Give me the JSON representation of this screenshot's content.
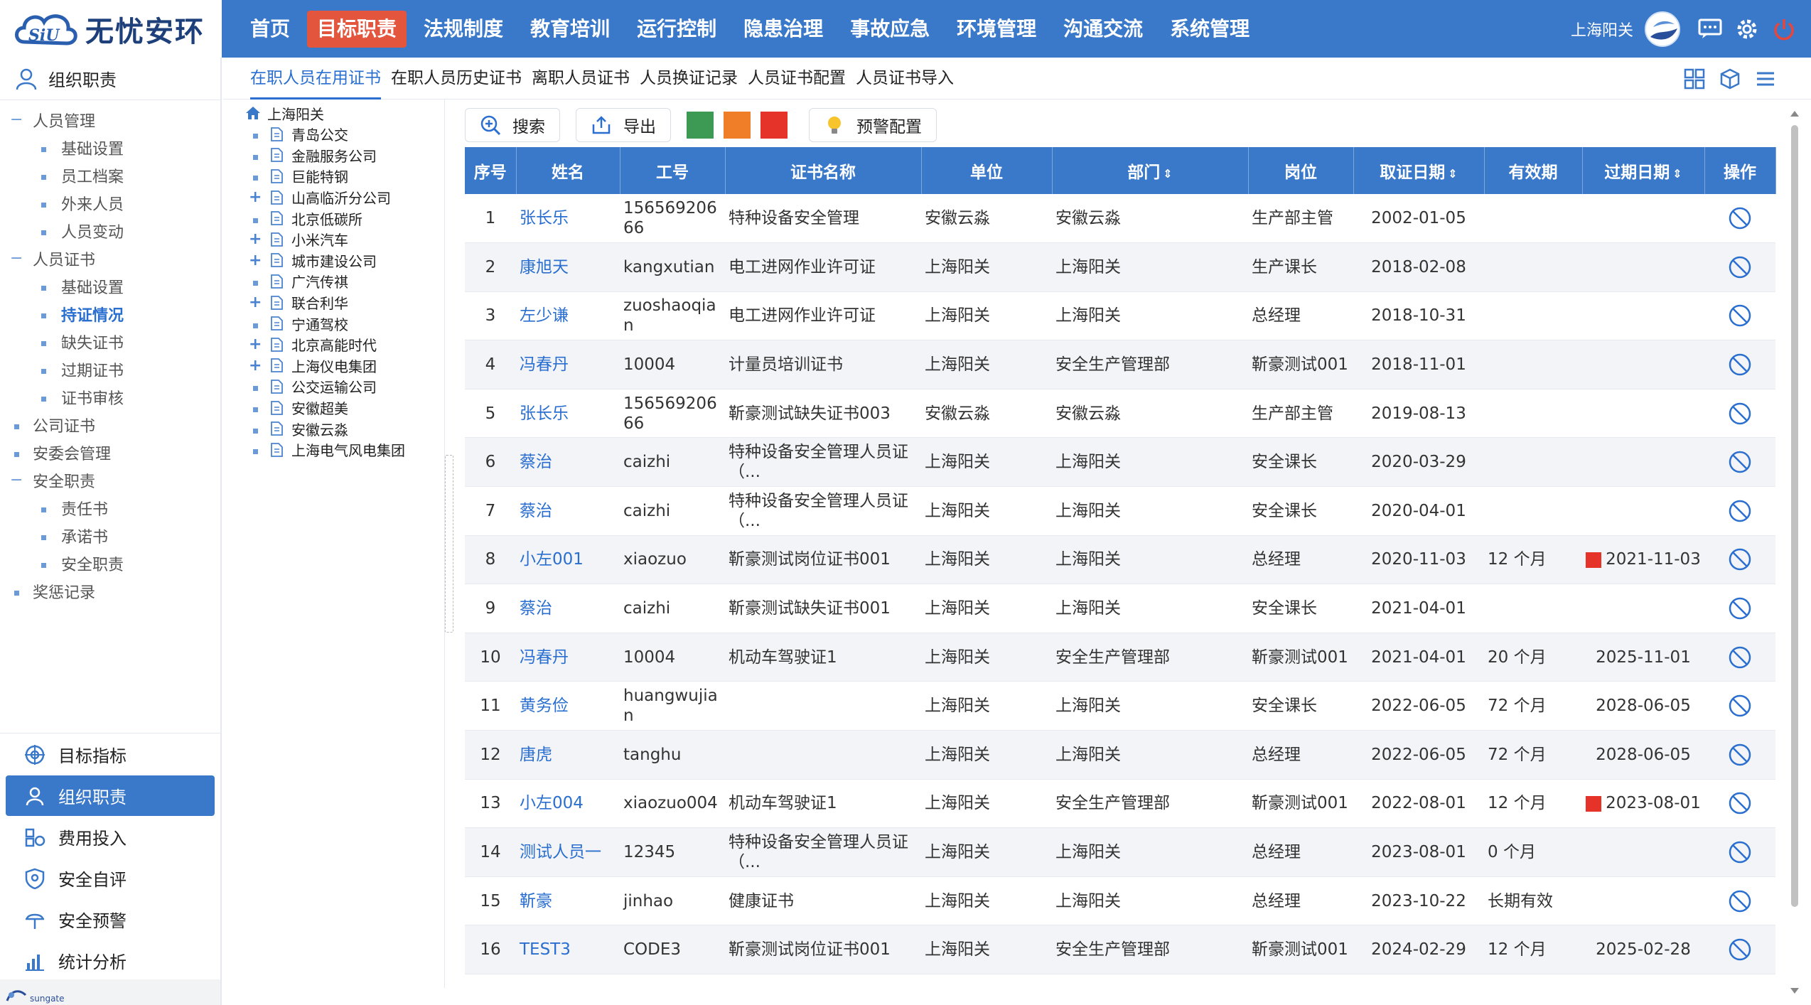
{
  "app": {
    "logo_text": "无忧安环",
    "logo_mark": "SiU",
    "user_name": "上海阳关",
    "colors": {
      "primary": "#3a78c9",
      "nav_active": "#e4553d",
      "link": "#2a6fd0",
      "warn_green": "#3d9a54",
      "warn_orange": "#f07e29",
      "warn_red": "#e53329"
    }
  },
  "nav": [
    "首页",
    "目标职责",
    "法规制度",
    "教育培训",
    "运行控制",
    "隐患治理",
    "事故应急",
    "环境管理",
    "沟通交流",
    "系统管理"
  ],
  "nav_active_index": 1,
  "top_icons": [
    "message-icon",
    "settings-icon",
    "power-icon"
  ],
  "sidebar": {
    "header": "组织职责",
    "tree": [
      {
        "level": 1,
        "mark": "−",
        "label": "人员管理"
      },
      {
        "level": 2,
        "label": "基础设置"
      },
      {
        "level": 2,
        "label": "员工档案"
      },
      {
        "level": 2,
        "label": "外来人员"
      },
      {
        "level": 2,
        "label": "人员变动"
      },
      {
        "level": 1,
        "mark": "−",
        "label": "人员证书"
      },
      {
        "level": 2,
        "label": "基础设置"
      },
      {
        "level": 2,
        "label": "持证情况",
        "active": true
      },
      {
        "level": 2,
        "label": "缺失证书"
      },
      {
        "level": 2,
        "label": "过期证书"
      },
      {
        "level": 2,
        "label": "证书审核"
      },
      {
        "level": 1,
        "mark": "dot",
        "label": "公司证书"
      },
      {
        "level": 1,
        "mark": "dot",
        "label": "安委会管理"
      },
      {
        "level": 1,
        "mark": "−",
        "label": "安全职责"
      },
      {
        "level": 2,
        "label": "责任书"
      },
      {
        "level": 2,
        "label": "承诺书"
      },
      {
        "level": 2,
        "label": "安全职责"
      },
      {
        "level": 1,
        "mark": "dot",
        "label": "奖惩记录"
      }
    ],
    "modules": [
      {
        "label": "目标指标",
        "icon": "target-icon"
      },
      {
        "label": "组织职责",
        "icon": "person-icon",
        "active": true
      },
      {
        "label": "费用投入",
        "icon": "money-icon"
      },
      {
        "label": "安全自评",
        "icon": "shield-icon"
      },
      {
        "label": "安全预警",
        "icon": "alarm-icon"
      },
      {
        "label": "统计分析",
        "icon": "chart-icon"
      }
    ],
    "footer_logo": "sungate"
  },
  "subtabs": [
    "在职人员在用证书",
    "在职人员历史证书",
    "离职人员证书",
    "人员换证记录",
    "人员证书配置",
    "人员证书导入"
  ],
  "subtab_active_index": 0,
  "org_tree": {
    "root": "上海阳关",
    "children": [
      {
        "label": "青岛公交",
        "expandable": false
      },
      {
        "label": "金融服务公司",
        "expandable": false
      },
      {
        "label": "巨能特钢",
        "expandable": false
      },
      {
        "label": "山高临沂分公司",
        "expandable": true
      },
      {
        "label": "北京低碳所",
        "expandable": false
      },
      {
        "label": "小米汽车",
        "expandable": true
      },
      {
        "label": "城市建设公司",
        "expandable": true
      },
      {
        "label": "广汽传祺",
        "expandable": false
      },
      {
        "label": "联合利华",
        "expandable": true
      },
      {
        "label": "宁通驾校",
        "expandable": false
      },
      {
        "label": "北京高能时代",
        "expandable": true
      },
      {
        "label": "上海仪电集团",
        "expandable": true
      },
      {
        "label": "公交运输公司",
        "expandable": false
      },
      {
        "label": "安徽超美",
        "expandable": false
      },
      {
        "label": "安徽云淼",
        "expandable": false
      },
      {
        "label": "上海电气风电集团",
        "expandable": false
      }
    ]
  },
  "toolbar": {
    "search": "搜索",
    "export": "导出",
    "warning_config": "预警配置"
  },
  "table": {
    "headers": [
      {
        "label": "序号",
        "sortable": false
      },
      {
        "label": "姓名",
        "sortable": false
      },
      {
        "label": "工号",
        "sortable": false
      },
      {
        "label": "证书名称",
        "sortable": false
      },
      {
        "label": "单位",
        "sortable": false
      },
      {
        "label": "部门",
        "sortable": true
      },
      {
        "label": "岗位",
        "sortable": false
      },
      {
        "label": "取证日期",
        "sortable": true
      },
      {
        "label": "有效期",
        "sortable": false
      },
      {
        "label": "过期日期",
        "sortable": true
      },
      {
        "label": "操作",
        "sortable": false
      }
    ],
    "rows": [
      {
        "no": "1",
        "name": "张长乐",
        "id": "15656920666",
        "cert": "特种设备安全管理",
        "unit": "安徽云淼",
        "dept": "安徽云淼",
        "post": "生产部主管",
        "issued": "2002-01-05",
        "valid": "",
        "expire": "",
        "expired": false
      },
      {
        "no": "2",
        "name": "康旭天",
        "id": "kangxutian",
        "cert": "电工进网作业许可证",
        "unit": "上海阳关",
        "dept": "上海阳关",
        "post": "生产课长",
        "issued": "2018-02-08",
        "valid": "",
        "expire": "",
        "expired": false
      },
      {
        "no": "3",
        "name": "左少谦",
        "id": "zuoshaoqian",
        "cert": "电工进网作业许可证",
        "unit": "上海阳关",
        "dept": "上海阳关",
        "post": "总经理",
        "issued": "2018-10-31",
        "valid": "",
        "expire": "",
        "expired": false
      },
      {
        "no": "4",
        "name": "冯春丹",
        "id": "10004",
        "cert": "计量员培训证书",
        "unit": "上海阳关",
        "dept": "安全生产管理部",
        "post": "靳豪测试001",
        "issued": "2018-11-01",
        "valid": "",
        "expire": "",
        "expired": false
      },
      {
        "no": "5",
        "name": "张长乐",
        "id": "15656920666",
        "cert": "靳豪测试缺失证书003",
        "unit": "安徽云淼",
        "dept": "安徽云淼",
        "post": "生产部主管",
        "issued": "2019-08-13",
        "valid": "",
        "expire": "",
        "expired": false
      },
      {
        "no": "6",
        "name": "蔡治",
        "id": "caizhi",
        "cert": "特种设备安全管理人员证（...",
        "unit": "上海阳关",
        "dept": "上海阳关",
        "post": "安全课长",
        "issued": "2020-03-29",
        "valid": "",
        "expire": "",
        "expired": false
      },
      {
        "no": "7",
        "name": "蔡治",
        "id": "caizhi",
        "cert": "特种设备安全管理人员证（...",
        "unit": "上海阳关",
        "dept": "上海阳关",
        "post": "安全课长",
        "issued": "2020-04-01",
        "valid": "",
        "expire": "",
        "expired": false
      },
      {
        "no": "8",
        "name": "小左001",
        "id": "xiaozuo",
        "cert": "靳豪测试岗位证书001",
        "unit": "上海阳关",
        "dept": "上海阳关",
        "post": "总经理",
        "issued": "2020-11-03",
        "valid": "12 个月",
        "expire": "2021-11-03",
        "expired": true
      },
      {
        "no": "9",
        "name": "蔡治",
        "id": "caizhi",
        "cert": "靳豪测试缺失证书001",
        "unit": "上海阳关",
        "dept": "上海阳关",
        "post": "安全课长",
        "issued": "2021-04-01",
        "valid": "",
        "expire": "",
        "expired": false
      },
      {
        "no": "10",
        "name": "冯春丹",
        "id": "10004",
        "cert": "机动车驾驶证1",
        "unit": "上海阳关",
        "dept": "安全生产管理部",
        "post": "靳豪测试001",
        "issued": "2021-04-01",
        "valid": "20 个月",
        "expire": "2025-11-01",
        "expired": false
      },
      {
        "no": "11",
        "name": "黄务俭",
        "id": "huangwujian",
        "cert": "",
        "unit": "上海阳关",
        "dept": "上海阳关",
        "post": "安全课长",
        "issued": "2022-06-05",
        "valid": "72 个月",
        "expire": "2028-06-05",
        "expired": false
      },
      {
        "no": "12",
        "name": "唐虎",
        "id": "tanghu",
        "cert": "",
        "unit": "上海阳关",
        "dept": "上海阳关",
        "post": "总经理",
        "issued": "2022-06-05",
        "valid": "72 个月",
        "expire": "2028-06-05",
        "expired": false
      },
      {
        "no": "13",
        "name": "小左004",
        "id": "xiaozuo004",
        "cert": "机动车驾驶证1",
        "unit": "上海阳关",
        "dept": "安全生产管理部",
        "post": "靳豪测试001",
        "issued": "2022-08-01",
        "valid": "12 个月",
        "expire": "2023-08-01",
        "expired": true
      },
      {
        "no": "14",
        "name": "测试人员一",
        "id": "12345",
        "cert": "特种设备安全管理人员证（...",
        "unit": "上海阳关",
        "dept": "上海阳关",
        "post": "总经理",
        "issued": "2023-08-01",
        "valid": "0 个月",
        "expire": "",
        "expired": false
      },
      {
        "no": "15",
        "name": "靳豪",
        "id": "jinhao",
        "cert": "健康证书",
        "unit": "上海阳关",
        "dept": "上海阳关",
        "post": "总经理",
        "issued": "2023-10-22",
        "valid": "长期有效",
        "expire": "",
        "expired": false
      },
      {
        "no": "16",
        "name": "TEST3",
        "id": "CODE3",
        "cert": "靳豪测试岗位证书001",
        "unit": "上海阳关",
        "dept": "安全生产管理部",
        "post": "靳豪测试001",
        "issued": "2024-02-29",
        "valid": "12 个月",
        "expire": "2025-02-28",
        "expired": false
      }
    ]
  }
}
